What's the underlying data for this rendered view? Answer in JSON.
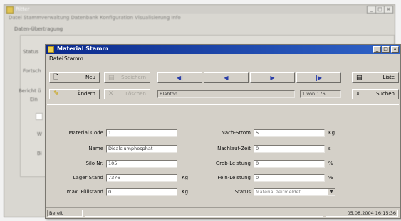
{
  "background_window": {
    "title": "Ritter",
    "menu": "Datei  Stammverwaltung  Datenbank  Konfiguration  Visualisierung  Info",
    "section": "Daten-Übertragung",
    "labels": [
      "Status",
      "Fortsch",
      "Bericht ü",
      "Ein",
      "W",
      "Bi"
    ],
    "controls": [
      "_",
      "□",
      "×"
    ]
  },
  "window": {
    "title": "Material Stamm",
    "controls": [
      "_",
      "□",
      "×"
    ],
    "menu": [
      "Datei",
      "Stamm"
    ]
  },
  "toolbar": {
    "new_label": "Neu",
    "save_label": "Speichern",
    "change_label": "Ändern",
    "delete_label": "Löschen",
    "nav_first": "◀|",
    "nav_prev": "◀",
    "nav_next": "▶",
    "nav_last": "|▶",
    "list_label": "Liste",
    "search_label": "Suchen",
    "record_name": "Blähton",
    "record_position": "1 von 176"
  },
  "fields_left": [
    {
      "label": "Material Code",
      "value": "1",
      "unit": ""
    },
    {
      "label": "Name",
      "value": "Dicalciumphosphat",
      "unit": ""
    },
    {
      "label": "Silo Nr.",
      "value": "105",
      "unit": ""
    },
    {
      "label": "Lager Stand",
      "value": "7376",
      "unit": "Kg"
    },
    {
      "label": "max. Füllstand",
      "value": "0",
      "unit": "Kg"
    }
  ],
  "fields_right": [
    {
      "label": "Nach-Strom",
      "value": "5",
      "unit": "Kg"
    },
    {
      "label": "Nachlauf-Zeit",
      "value": "0",
      "unit": "s"
    },
    {
      "label": "Grob-Leistung",
      "value": "0",
      "unit": "%"
    },
    {
      "label": "Fein-Leistung",
      "value": "0",
      "unit": "%"
    },
    {
      "label": "Status",
      "value": "Material zeitmeldet",
      "unit": ""
    }
  ],
  "status": {
    "state": "Bereit",
    "datetime": "05.08.2004 16:15:36"
  },
  "colors": {
    "title_left": "#0c2a8c",
    "title_right": "#2f63c8",
    "window_face": "#d4d0c8"
  }
}
